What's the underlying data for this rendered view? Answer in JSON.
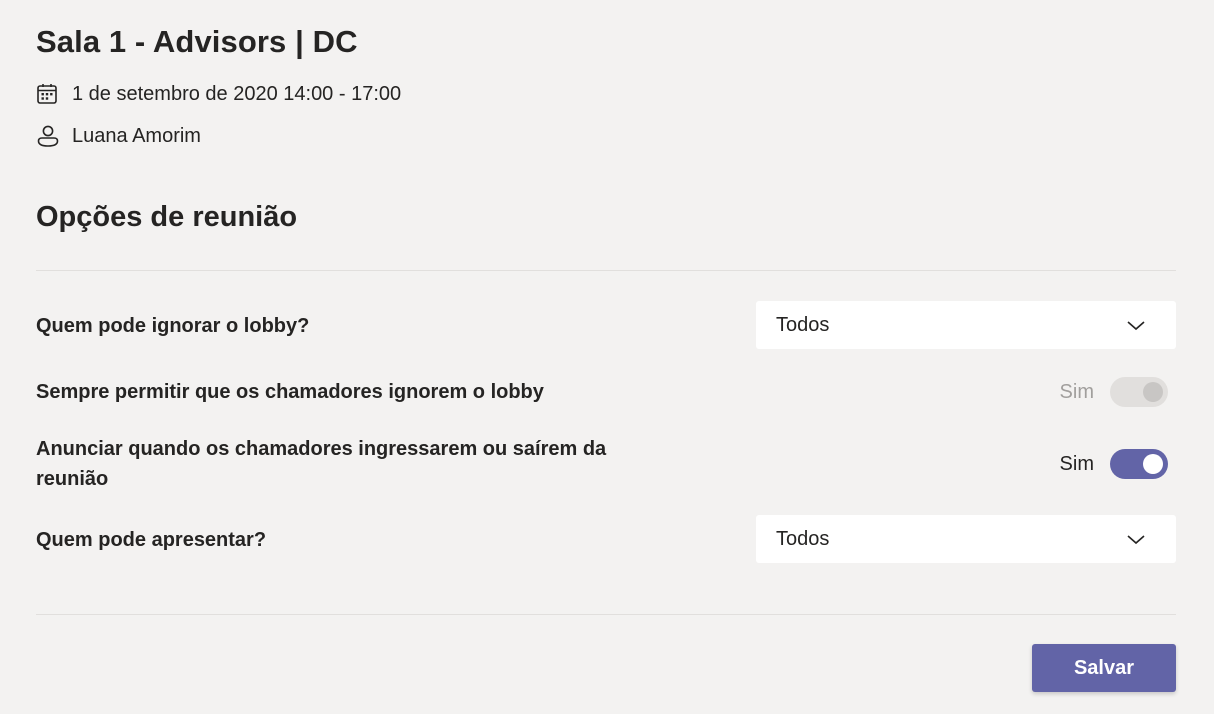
{
  "meeting": {
    "title": "Sala 1 - Advisors | DC",
    "datetime": "1 de setembro de 2020 14:00 - 17:00",
    "organizer": "Luana Amorim",
    "icons": {
      "date": "calendar-icon",
      "organizer": "person-icon"
    }
  },
  "options": {
    "section_title": "Opções de reunião",
    "lobby_bypass": {
      "label": "Quem pode ignorar o lobby?",
      "value": "Todos",
      "icon": "chevron-down-icon"
    },
    "callers_bypass": {
      "label": "Sempre permitir que os chamadores ignorem o lobby",
      "state_text": "Sim",
      "enabled": false,
      "checked": true
    },
    "announce_callers": {
      "label": "Anunciar quando os chamadores ingressarem ou saírem da reunião",
      "state_text": "Sim",
      "enabled": true,
      "checked": true
    },
    "presenters": {
      "label": "Quem pode apresentar?",
      "value": "Todos",
      "icon": "chevron-down-icon"
    }
  },
  "actions": {
    "save_label": "Salvar"
  },
  "colors": {
    "accent": "#6264a7",
    "background": "#f3f2f1",
    "text": "#252423",
    "disabled_text": "#a19f9d"
  }
}
